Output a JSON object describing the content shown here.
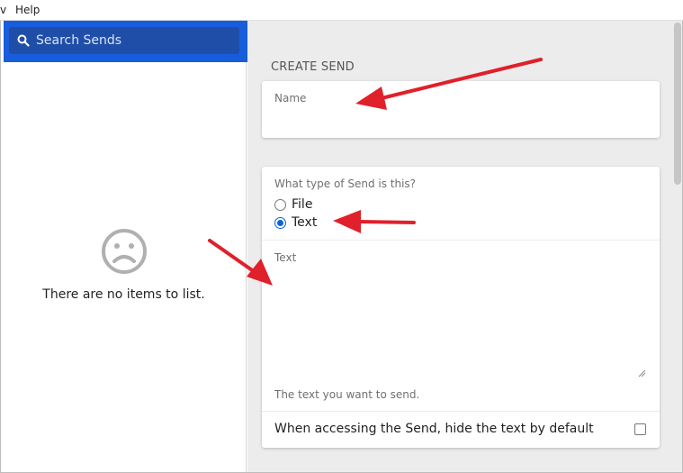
{
  "menubar": {
    "prev_menu_label": "v",
    "help_label": "Help"
  },
  "search": {
    "placeholder": "Search Sends",
    "icon": "search-icon"
  },
  "sidebar": {
    "empty_icon": "sad-face-icon",
    "empty_text": "There are no items to list."
  },
  "create_send": {
    "section_title": "CREATE SEND",
    "name_label": "Name",
    "name_value": "",
    "type_question": "What type of Send is this?",
    "type_options": [
      {
        "label": "File",
        "checked": false
      },
      {
        "label": "Text",
        "checked": true
      }
    ],
    "text_label": "Text",
    "text_value": "",
    "text_hint": "The text you want to send.",
    "hide_text_label": "When accessing the Send, hide the text by default",
    "hide_text_checked": false
  },
  "colors": {
    "accent": "#175ddc",
    "annotation_arrow": "#e0202a"
  }
}
